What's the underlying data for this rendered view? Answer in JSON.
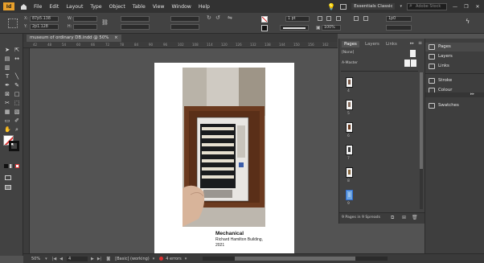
{
  "app": {
    "logo": "Id"
  },
  "menu": {
    "items": [
      "File",
      "Edit",
      "Layout",
      "Type",
      "Object",
      "Table",
      "View",
      "Window",
      "Help"
    ],
    "workspace": "Essentials Classic",
    "search_placeholder": "Adobe Stock",
    "window_controls": [
      "—",
      "❐",
      "✕"
    ]
  },
  "control": {
    "x_label": "X:",
    "x_value": "87p5.138",
    "y_label": "Y:",
    "y_value": "2p1.128",
    "w_label": "W:",
    "h_label": "H:",
    "stroke_weight": "1 pt",
    "opacity": "100%",
    "gutter": "1p0"
  },
  "tabs": {
    "doc_title": "museum of ordinary DB.indd @ 50%",
    "close": "×"
  },
  "ruler": {
    "h_ticks": [
      "42",
      "48",
      "54",
      "60",
      "66",
      "72",
      "78",
      "84",
      "90",
      "96",
      "102",
      "108",
      "114",
      "120",
      "126",
      "132",
      "138",
      "144",
      "150",
      "156",
      "162"
    ]
  },
  "page": {
    "caption_title": "Mechanical",
    "caption_line1": "Richard Hamilton Building,",
    "caption_line2": "2021"
  },
  "status": {
    "zoom": "50%",
    "page_number": "4",
    "style": "[Basic] (working)",
    "errors": "4 errors"
  },
  "pages_panel": {
    "tabs": [
      "Pages",
      "Layers",
      "Links"
    ],
    "none_label": "[None]",
    "master_label": "A-Master",
    "page_numbers": [
      "4",
      "5",
      "6",
      "7",
      "8",
      "9"
    ],
    "footer": "9 Pages in 9 Spreads"
  },
  "dock": {
    "items": [
      "Pages",
      "Layers",
      "Links",
      "Stroke",
      "Colour",
      "Swatches"
    ]
  },
  "colors": {
    "menubar_bg": "#323232",
    "panel_bg": "#424242",
    "pasteboard": "#535353",
    "accent": "#e8a02b",
    "frame": "#6b3a1f"
  }
}
